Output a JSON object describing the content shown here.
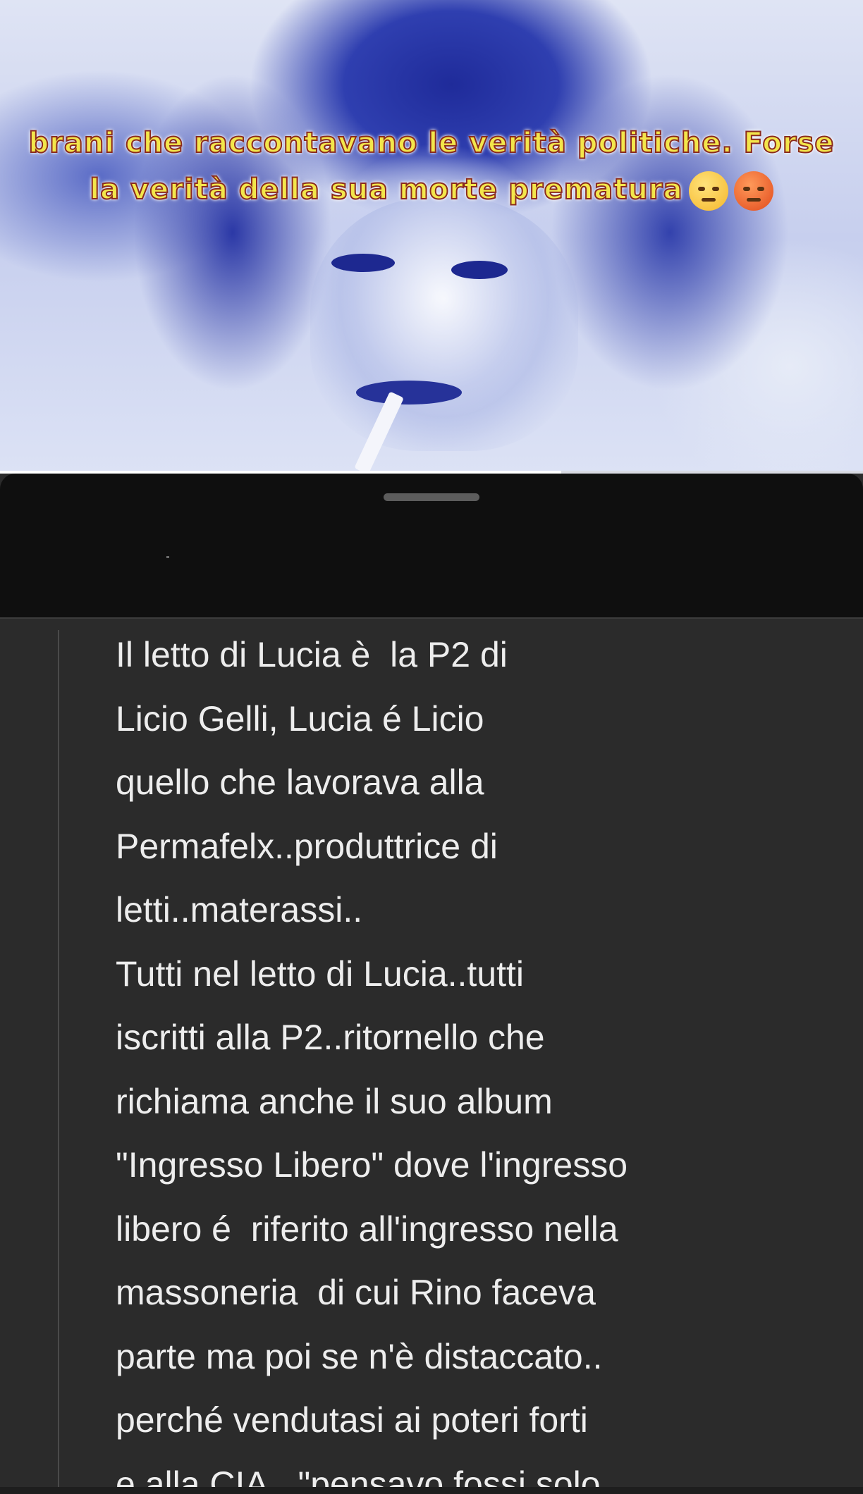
{
  "video": {
    "caption_lines": [
      "brani che raccontavano le verità politiche. Forse",
      "la verità della sua morte prematura"
    ],
    "caption_emojis": [
      "pensive-face",
      "angry-face"
    ],
    "progress_fraction": 0.65
  },
  "comment": {
    "lines": [
      "Il letto di Lucia è  la P2 di",
      "Licio Gelli, Lucia é Licio",
      "quello che lavorava alla",
      "Permafelx..produttrice di",
      "letti..materassi..",
      "Tutti nel letto di Lucia..tutti",
      "iscritti alla P2..ritornello che",
      "richiama anche il suo album",
      "\"Ingresso Libero\" dove l'ingresso",
      "libero é  riferito all'ingresso nella",
      "massoneria  di cui Rino faceva",
      "parte ma poi se n'è distaccato..",
      "perché vendutasi ai poteri forti",
      "e alla CIA...\"pensavo fossi solo"
    ]
  }
}
